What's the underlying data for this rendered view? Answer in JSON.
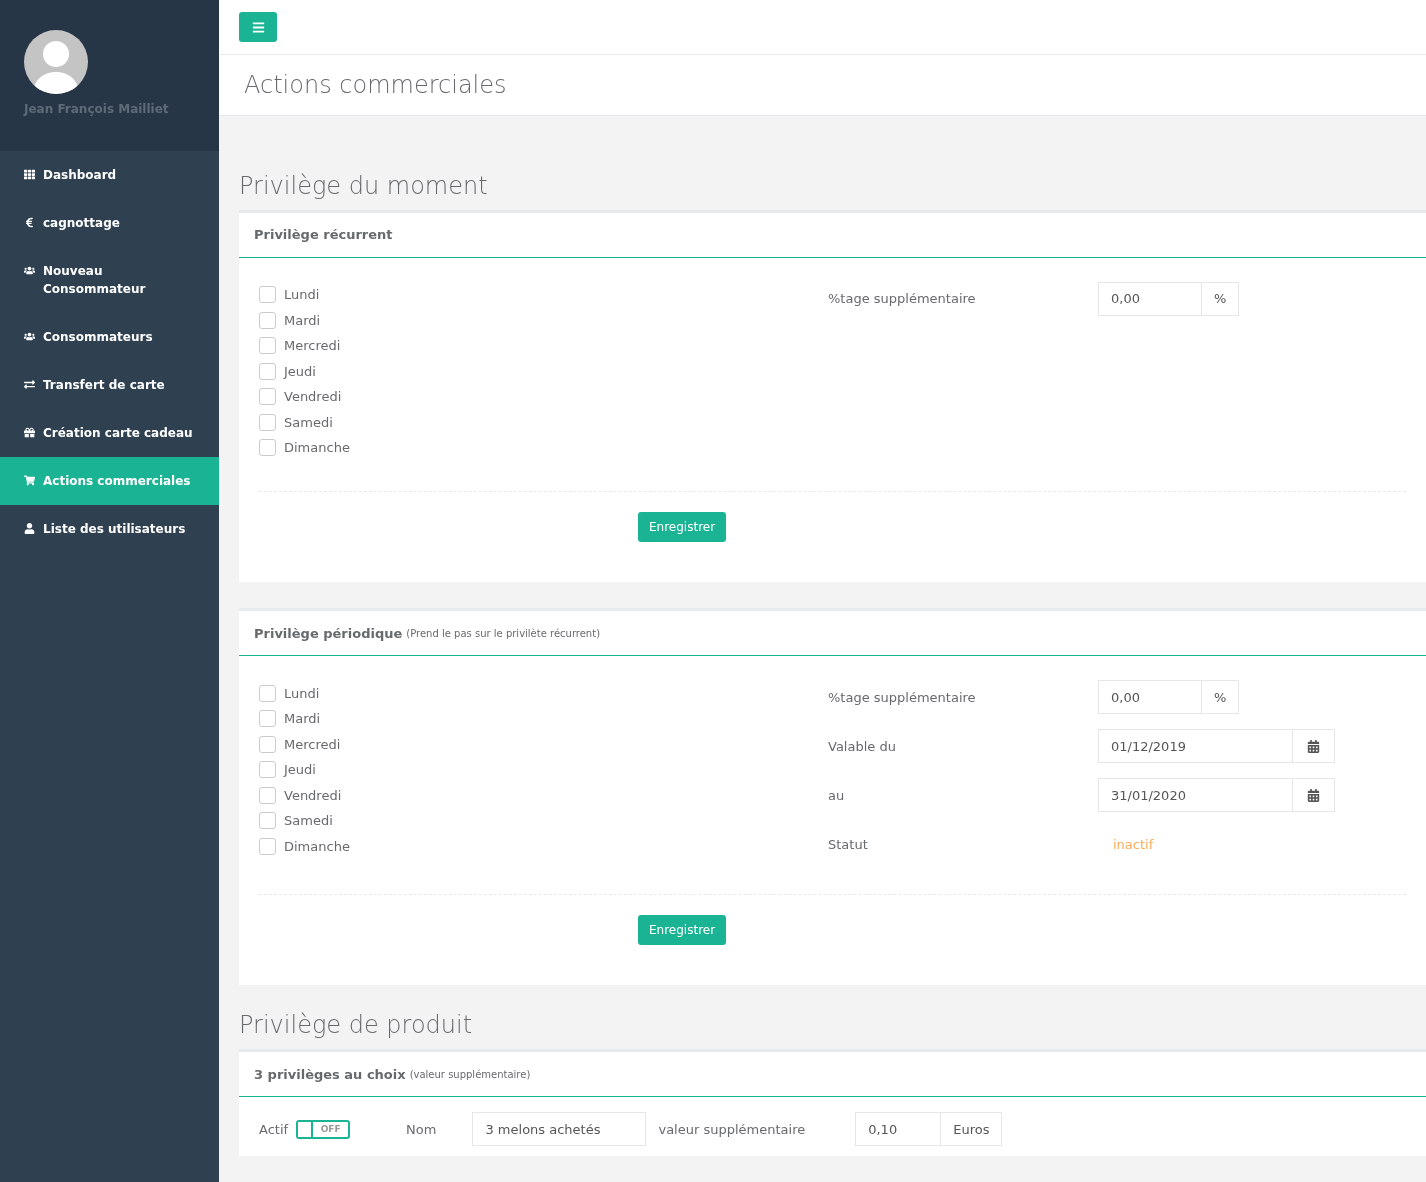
{
  "sidebar": {
    "user": "Jean François Mailliet",
    "items": [
      {
        "label": "Dashboard",
        "kind": "grid",
        "selected": false
      },
      {
        "label": "cagnottage",
        "kind": "euro",
        "selected": false
      },
      {
        "label": "Nouveau Consommateur",
        "kind": "users",
        "selected": false
      },
      {
        "label": "Consommateurs",
        "kind": "users",
        "selected": false
      },
      {
        "label": "Transfert de carte",
        "kind": "exchange",
        "selected": false
      },
      {
        "label": "Création carte cadeau",
        "kind": "gift",
        "selected": false
      },
      {
        "label": "Actions commerciales",
        "kind": "cart",
        "selected": true
      },
      {
        "label": "Liste des utilisateurs",
        "kind": "user",
        "selected": false
      }
    ]
  },
  "page_title": "Actions commerciales",
  "sections": [
    {
      "title": "Privilège du moment",
      "panels": [
        {
          "kind": "days",
          "title": "Privilège récurrent",
          "days": [
            {
              "label": "Lundi",
              "checked": false
            },
            {
              "label": "Mardi",
              "checked": false
            },
            {
              "label": "Mercredi",
              "checked": false
            },
            {
              "label": "Jeudi",
              "checked": false
            },
            {
              "label": "Vendredi",
              "checked": false
            },
            {
              "label": "Samedi",
              "checked": false
            },
            {
              "label": "Dimanche",
              "checked": false
            }
          ],
          "fields": [
            {
              "kind": "addon",
              "label": "%tage supplémentaire",
              "value": "0,00",
              "addon": "%"
            }
          ],
          "button": "Enregistrer"
        },
        {
          "kind": "days",
          "title": "Privilège périodique",
          "subtitle": "(Prend le pas sur le privilète récurrent)",
          "days": [
            {
              "label": "Lundi",
              "checked": false
            },
            {
              "label": "Mardi",
              "checked": false
            },
            {
              "label": "Mercredi",
              "checked": false
            },
            {
              "label": "Jeudi",
              "checked": false
            },
            {
              "label": "Vendredi",
              "checked": false
            },
            {
              "label": "Samedi",
              "checked": false
            },
            {
              "label": "Dimanche",
              "checked": false
            }
          ],
          "fields": [
            {
              "kind": "addon",
              "label": "%tage supplémentaire",
              "value": "0,00",
              "addon": "%"
            },
            {
              "kind": "date",
              "label": "Valable du",
              "value": "01/12/2019"
            },
            {
              "kind": "date",
              "label": "au",
              "value": "31/01/2020"
            },
            {
              "kind": "status",
              "label": "Statut",
              "value": "inactif",
              "active": false
            }
          ],
          "button": "Enregistrer"
        }
      ]
    },
    {
      "title": "Privilège de produit",
      "panels": [
        {
          "kind": "products",
          "title": "3 privilèges au choix",
          "subtitle": "(valeur supplémentaire)",
          "rows": [
            {
              "active_label": "Actif",
              "on": false,
              "toggle_text": "OFF",
              "name_label": "Nom",
              "name": "3 melons achetés",
              "value_label": "valeur supplémentaire",
              "value": "0,10",
              "unit": "Euros"
            }
          ]
        }
      ]
    }
  ]
}
